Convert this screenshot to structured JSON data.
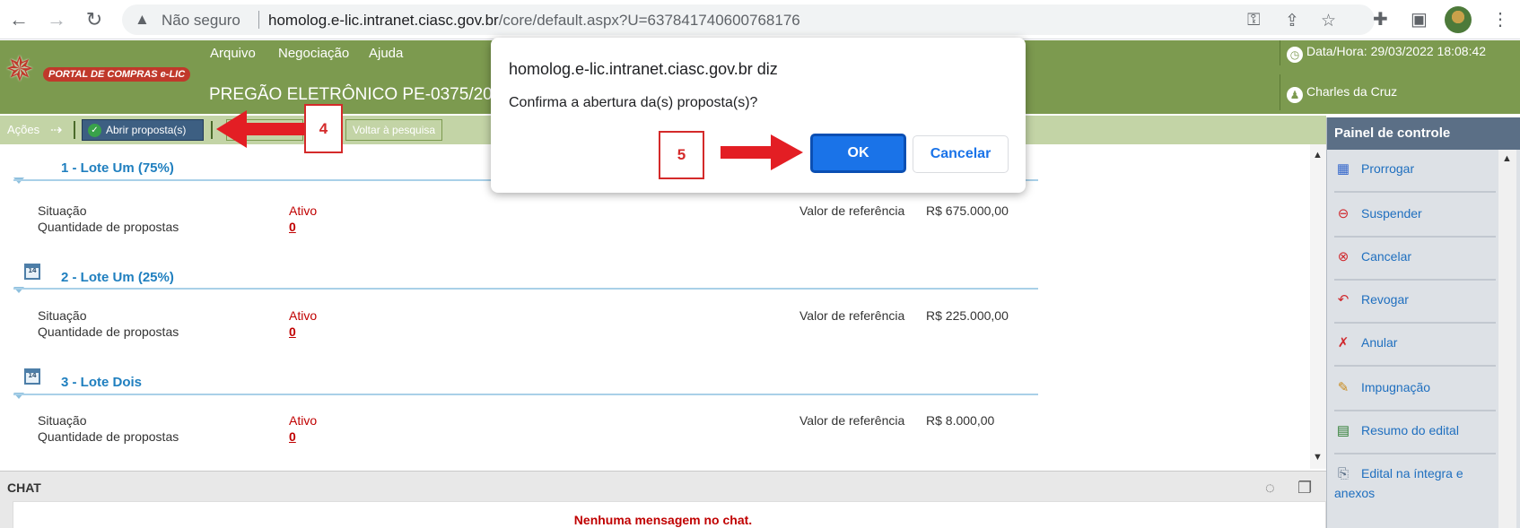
{
  "browser": {
    "insecure_label": "Não seguro",
    "url_host": "homolog.e-lic.intranet.ciasc.gov.br",
    "url_path": "/core/default.aspx?U=637841740600768176"
  },
  "header": {
    "logo_text": "PORTAL DE COMPRAS e-LIC",
    "menu": [
      "Arquivo",
      "Negociação",
      "Ajuda"
    ],
    "page_title": "PREGÃO ELETRÔNICO PE-0375/2021",
    "datetime": "Data/Hora: 29/03/2022 18:08:42",
    "user": "Charles da Cruz"
  },
  "toolbar": {
    "acoes_label": "Ações",
    "open_proposals": "Abrir proposta(s)",
    "hidden_button_fragment": "ar",
    "back_to_search": "Voltar à pesquisa"
  },
  "annotations": {
    "step4": "4",
    "step5": "5",
    "colors": {
      "red": "#e31e24"
    }
  },
  "lots": [
    {
      "title": "1 - Lote Um (75%)",
      "situacao_label": "Situação",
      "situacao": "Ativo",
      "qtd_label": "Quantidade de propostas",
      "qtd": "0",
      "ref_label": "Valor de referência",
      "ref_value": "R$  675.000,00"
    },
    {
      "title": "2 - Lote Um (25%)",
      "situacao_label": "Situação",
      "situacao": "Ativo",
      "qtd_label": "Quantidade de propostas",
      "qtd": "0",
      "ref_label": "Valor de referência",
      "ref_value": "R$  225.000,00",
      "calendar_icon_label": "14"
    },
    {
      "title": "3 - Lote Dois",
      "situacao_label": "Situação",
      "situacao": "Ativo",
      "qtd_label": "Quantidade de propostas",
      "qtd": "0",
      "ref_label": "Valor de referência",
      "ref_value": "R$  8.000,00",
      "calendar_icon_label": "14"
    }
  ],
  "panel": {
    "title": "Painel de controle",
    "items": [
      {
        "label": "Prorrogar",
        "icon": "calendar-plus-icon"
      },
      {
        "label": "Suspender",
        "icon": "minus-circle-icon"
      },
      {
        "label": "Cancelar",
        "icon": "x-circle-icon"
      },
      {
        "label": "Revogar",
        "icon": "undo-document-icon"
      },
      {
        "label": "Anular",
        "icon": "cross-document-icon"
      },
      {
        "label": "Impugnação",
        "icon": "pencil-icon"
      },
      {
        "label": "Resumo do edital",
        "icon": "document-icon"
      },
      {
        "label": "Edital na íntegra e",
        "label2": "anexos",
        "icon": "paperclip-icon"
      }
    ]
  },
  "chat": {
    "title": "CHAT",
    "empty_message": "Nenhuma mensagem no chat."
  },
  "dialog": {
    "origin": "homolog.e-lic.intranet.ciasc.gov.br diz",
    "message": "Confirma a abertura da(s) proposta(s)?",
    "ok": "OK",
    "cancel": "Cancelar"
  }
}
